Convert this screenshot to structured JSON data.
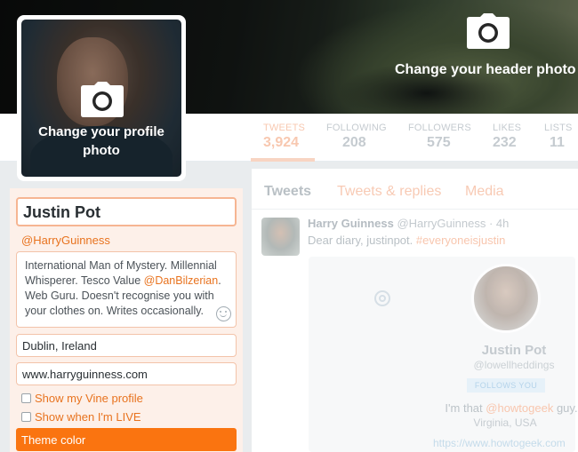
{
  "header": {
    "change_header_label": "Change your header photo",
    "icon": "camera-icon"
  },
  "profile_photo": {
    "change_label_line1": "Change your profile",
    "change_label_line2": "photo",
    "icon": "camera-icon"
  },
  "nav": {
    "stats": [
      {
        "label": "TWEETS",
        "value": "3,924"
      },
      {
        "label": "FOLLOWING",
        "value": "208"
      },
      {
        "label": "FOLLOWERS",
        "value": "575"
      },
      {
        "label": "LIKES",
        "value": "232"
      },
      {
        "label": "LISTS",
        "value": "11"
      }
    ]
  },
  "edit": {
    "name": "Justin Pot",
    "handle": "@HarryGuinness",
    "bio_part1": "International Man of Mystery. Millennial Whisperer. Tesco Value ",
    "bio_mention": "@DanBilzerian",
    "bio_part2": ". Web Guru. Doesn't recognise you with your clothes on. Writes occasionally.",
    "location": "Dublin, Ireland",
    "website": "www.harryguinness.com",
    "vine_label": "Show my Vine profile",
    "live_label": "Show when I'm LIVE",
    "theme_label": "Theme color"
  },
  "tabs": [
    "Tweets",
    "Tweets & replies",
    "Media"
  ],
  "tweet": {
    "author": "Harry Guinness",
    "handle": "@HarryGuinness",
    "time": "· 4h",
    "text": "Dear diary, justinpot. ",
    "hashtag": "#everyoneisjustin"
  },
  "card": {
    "name": "Justin Pot",
    "handle": "@lowellheddings",
    "follows": "FOLLOWS YOU",
    "bio_part1": "I'm that ",
    "bio_mention": "@howtogeek",
    "bio_part2": " guy.",
    "location": "Virginia, USA",
    "url": "https://www.howtogeek.com"
  },
  "colors": {
    "accent": "#fa7410",
    "link": "#e8731f"
  }
}
